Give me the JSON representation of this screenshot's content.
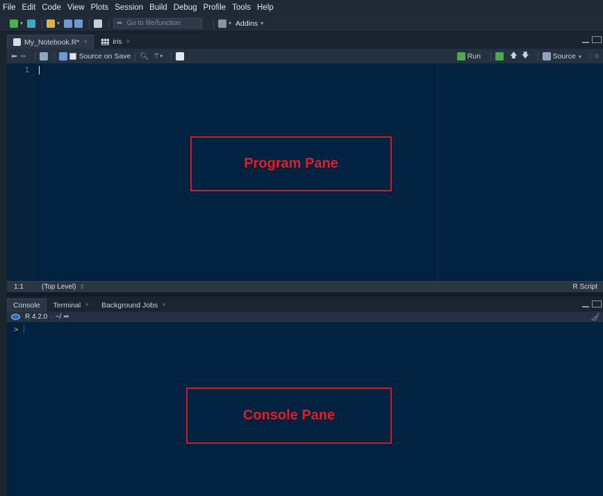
{
  "menu": [
    "File",
    "Edit",
    "Code",
    "View",
    "Plots",
    "Session",
    "Build",
    "Debug",
    "Profile",
    "Tools",
    "Help"
  ],
  "toolbar": {
    "goto_placeholder": "Go to file/function",
    "addins_label": "Addins"
  },
  "editor": {
    "tabs": [
      {
        "label": "My_Notebook.R*",
        "icon": "r-file-icon"
      },
      {
        "label": "iris",
        "icon": "data-grid-icon"
      }
    ],
    "source_on_save_label": "Source on Save",
    "run_label": "Run",
    "source_label": "Source",
    "line_numbers": [
      "1"
    ],
    "status": {
      "position": "1:1",
      "scope": "(Top Level)",
      "file_type": "R Script"
    }
  },
  "console": {
    "tabs": [
      "Console",
      "Terminal",
      "Background Jobs"
    ],
    "r_version": "R 4.2.0",
    "path": "~/",
    "prompt": ">"
  },
  "annotations": {
    "program_pane": "Program Pane",
    "console_pane": "Console Pane"
  },
  "colors": {
    "editor_bg": "#002240",
    "annotation_red": "#e21d25"
  }
}
